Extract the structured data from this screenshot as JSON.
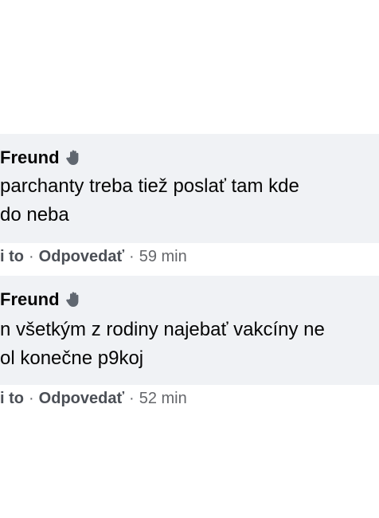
{
  "comments": [
    {
      "author": "Freund",
      "author_badge_icon": "hand-icon",
      "lines": [
        "parchanty treba tiež poslať tam kde",
        "do neba"
      ],
      "like_label": "i to",
      "reply_label": "Odpovedať",
      "separator": "·",
      "time": "59 min"
    },
    {
      "author": "Freund",
      "author_badge_icon": "hand-icon",
      "lines": [
        "n všetkým z rodiny najebať vakcíny ne",
        "ol konečne p9koj"
      ],
      "like_label": "i to",
      "reply_label": "Odpovedať",
      "separator": "·",
      "time": "52 min"
    }
  ],
  "colors": {
    "bubble_bg": "#f0f2f5",
    "text": "#050505",
    "meta": "#65676b"
  }
}
